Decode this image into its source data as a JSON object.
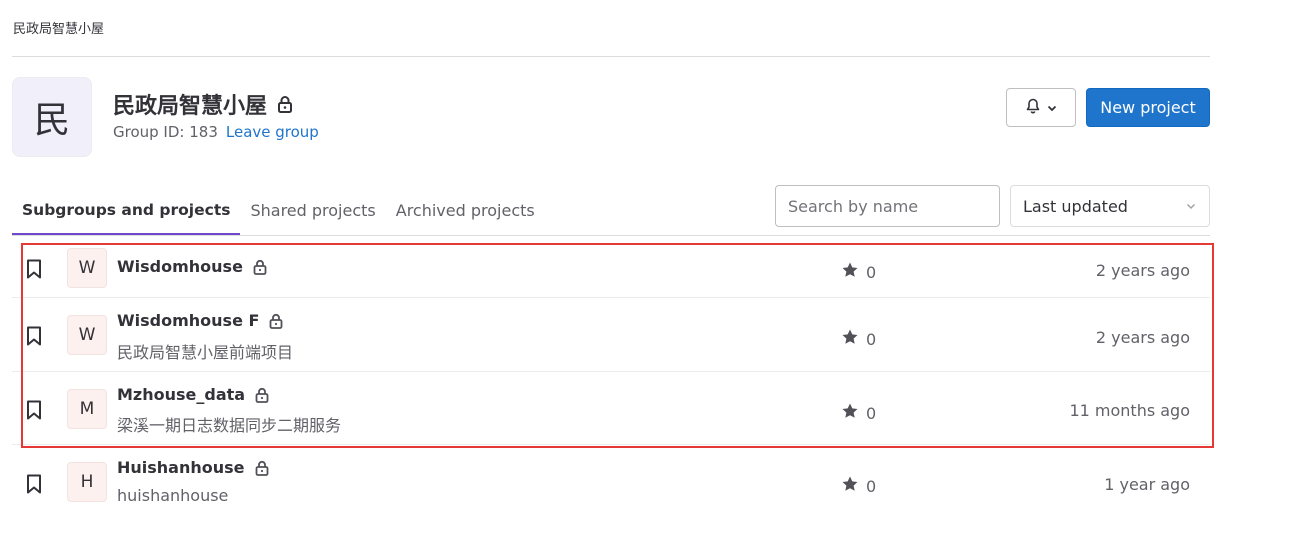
{
  "breadcrumb": "民政局智慧小屋",
  "group": {
    "avatar_letter": "民",
    "name": "民政局智慧小屋",
    "id_label": "Group ID: 183",
    "leave_label": "Leave group"
  },
  "actions": {
    "new_project_label": "New project"
  },
  "tabs": [
    {
      "label": "Subgroups and projects"
    },
    {
      "label": "Shared projects"
    },
    {
      "label": "Archived projects"
    }
  ],
  "search": {
    "placeholder": "Search by name",
    "value": ""
  },
  "sort": {
    "selected": "Last updated"
  },
  "projects": [
    {
      "avatar": "W",
      "name": "Wisdomhouse",
      "description": "",
      "stars": "0",
      "updated": "2 years ago"
    },
    {
      "avatar": "W",
      "name": "Wisdomhouse F",
      "description": "民政局智慧小屋前端项目",
      "stars": "0",
      "updated": "2 years ago"
    },
    {
      "avatar": "M",
      "name": "Mzhouse_data",
      "description": "梁溪一期日志数据同步二期服务",
      "stars": "0",
      "updated": "11 months ago"
    },
    {
      "avatar": "H",
      "name": "Huishanhouse",
      "description": "huishanhouse",
      "stars": "0",
      "updated": "1 year ago"
    }
  ],
  "colors": {
    "accent": "#1f75cb",
    "tab_active": "#6e49cb",
    "highlight": "#e53935"
  }
}
